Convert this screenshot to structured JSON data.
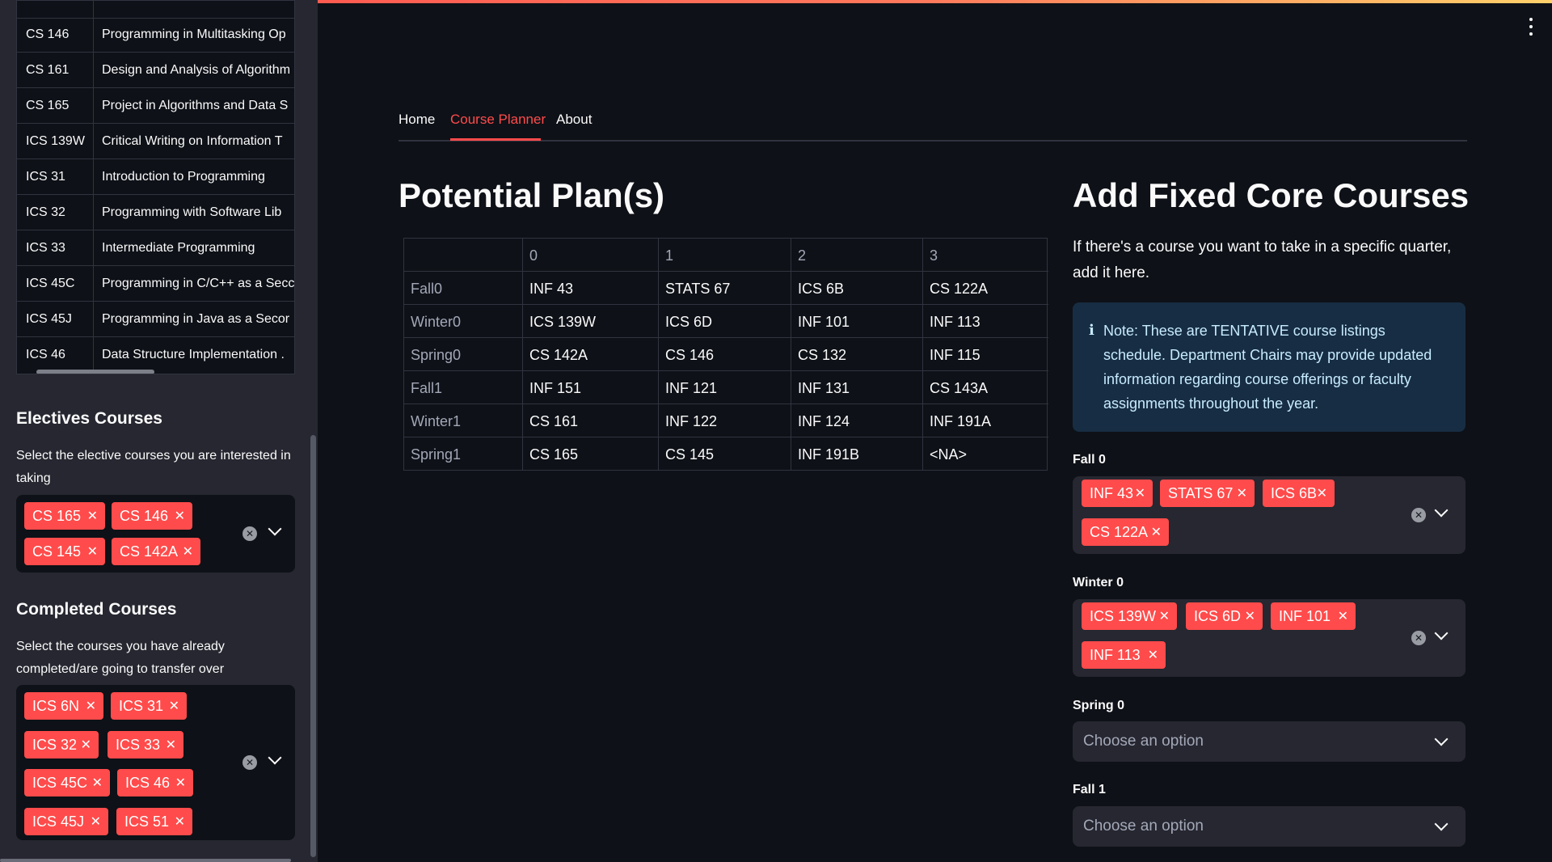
{
  "menu_icon": "kebab-menu-icon",
  "sidebar": {
    "course_table": [
      {
        "code": "CS 146",
        "title": "Programming in Multitasking Op"
      },
      {
        "code": "CS 161",
        "title": "Design and Analysis of Algorithm"
      },
      {
        "code": "CS 165",
        "title": "Project in Algorithms and Data S"
      },
      {
        "code": "ICS 139W",
        "title": "Critical Writing on Information T"
      },
      {
        "code": "ICS 31",
        "title": "Introduction to Programming"
      },
      {
        "code": "ICS 32",
        "title": "Programming with Software Lib"
      },
      {
        "code": "ICS 33",
        "title": "Intermediate Programming"
      },
      {
        "code": "ICS 45C",
        "title": "Programming in C/C++ as a Secc"
      },
      {
        "code": "ICS 45J",
        "title": "Programming in Java as a Secor"
      },
      {
        "code": "ICS 46",
        "title": "Data Structure Implementation ."
      }
    ],
    "electives": {
      "title": "Electives Courses",
      "description": "Select the elective courses you are interested in taking",
      "selected": [
        "CS 165",
        "CS 146",
        "CS 145",
        "CS 142A"
      ]
    },
    "completed": {
      "title": "Completed Courses",
      "description": "Select the courses you have already completed/are going to transfer over",
      "selected": [
        "ICS 6N",
        "ICS 31",
        "ICS 32",
        "ICS 33",
        "ICS 45C",
        "ICS 46",
        "ICS 45J",
        "ICS 51"
      ]
    }
  },
  "tabs": [
    {
      "label": "Home",
      "active": false
    },
    {
      "label": "Course Planner",
      "active": true
    },
    {
      "label": "About",
      "active": false
    }
  ],
  "plans": {
    "title": "Potential Plan(s)",
    "columns": [
      "",
      "0",
      "1",
      "2",
      "3"
    ],
    "rows": [
      {
        "index": "Fall0",
        "cells": [
          "INF 43",
          "STATS 67",
          "ICS 6B",
          "CS 122A"
        ]
      },
      {
        "index": "Winter0",
        "cells": [
          "ICS 139W",
          "ICS 6D",
          "INF 101",
          "INF 113"
        ]
      },
      {
        "index": "Spring0",
        "cells": [
          "CS 142A",
          "CS 146",
          "CS 132",
          "INF 115"
        ]
      },
      {
        "index": "Fall1",
        "cells": [
          "INF 151",
          "INF 121",
          "INF 131",
          "CS 143A"
        ]
      },
      {
        "index": "Winter1",
        "cells": [
          "CS 161",
          "INF 122",
          "INF 124",
          "INF 191A"
        ]
      },
      {
        "index": "Spring1",
        "cells": [
          "CS 165",
          "CS 145",
          "INF 191B",
          "<NA>"
        ]
      }
    ]
  },
  "fixed": {
    "title": "Add Fixed Core Courses",
    "description": "If there's a course you want to take in a specific quarter, add it here.",
    "note": "Note: These are TENTATIVE course listings schedule. Department Chairs may provide updated information regarding course offerings or faculty assignments throughout the year.",
    "quarters": [
      {
        "label": "Fall 0",
        "selected": [
          "INF 43",
          "STATS 67",
          "ICS 6B",
          "CS 122A"
        ],
        "placeholder": ""
      },
      {
        "label": "Winter 0",
        "selected": [
          "ICS 139W",
          "ICS 6D",
          "INF 101",
          "INF 113"
        ],
        "placeholder": ""
      },
      {
        "label": "Spring 0",
        "selected": [],
        "placeholder": "Choose an option"
      },
      {
        "label": "Fall 1",
        "selected": [],
        "placeholder": "Choose an option"
      }
    ]
  },
  "colors": {
    "accent": "#ff4b4b",
    "background": "#0e1117",
    "sidebar": "#262730",
    "info_bg": "#172d43",
    "info_text": "#c7ebff"
  }
}
